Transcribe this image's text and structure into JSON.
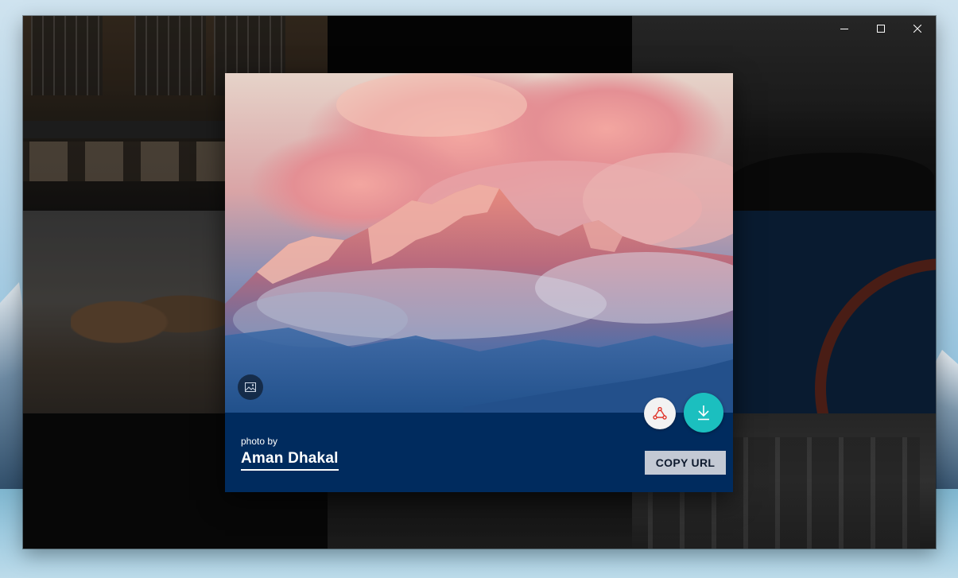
{
  "window": {
    "caption_buttons": [
      {
        "name": "minimize",
        "icon": "minimize-icon"
      },
      {
        "name": "maximize",
        "icon": "maximize-icon"
      },
      {
        "name": "close",
        "icon": "close-icon"
      }
    ]
  },
  "photo_dialog": {
    "credit_label": "photo by",
    "photographer": "Aman Dhakal",
    "copy_url_label": "COPY URL",
    "icons": {
      "image_button": "image-icon",
      "share_button": "share-icon",
      "download_button": "download-arrow-icon"
    },
    "colors": {
      "panel": "#002b5e",
      "download_accent": "#1bbfbf",
      "share_icon": "#e0352b",
      "copy_button_bg": "#c3c9d4"
    }
  }
}
